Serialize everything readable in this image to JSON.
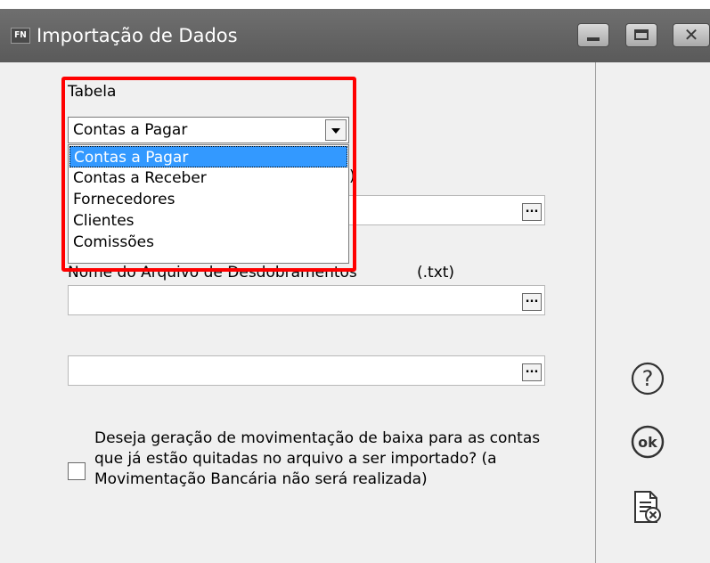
{
  "window": {
    "app_badge": "FN",
    "title": "Importação de Dados"
  },
  "tabela": {
    "label": "Tabela",
    "selected": "Contas a Pagar",
    "options": [
      "Contas a Pagar",
      "Contas a Receber",
      "Fornecedores",
      "Clientes",
      "Comissões"
    ]
  },
  "hidden_label_suffix": ")",
  "desdobramentos": {
    "label": "Nome do Arquivo de Desdobramentos",
    "ext": "(.txt)"
  },
  "browse_label": "...",
  "checkbox": {
    "text": "Deseja geração de movimentação de baixa para as contas que já estão quitadas no arquivo a ser importado? (a Movimentação Bancária não será realizada)",
    "checked": false
  },
  "side_icons": [
    "help-icon",
    "ok-icon",
    "cancel-document-icon"
  ],
  "colors": {
    "highlight": "#ff0000",
    "selection": "#3399ff",
    "titlebar": "#636363"
  }
}
